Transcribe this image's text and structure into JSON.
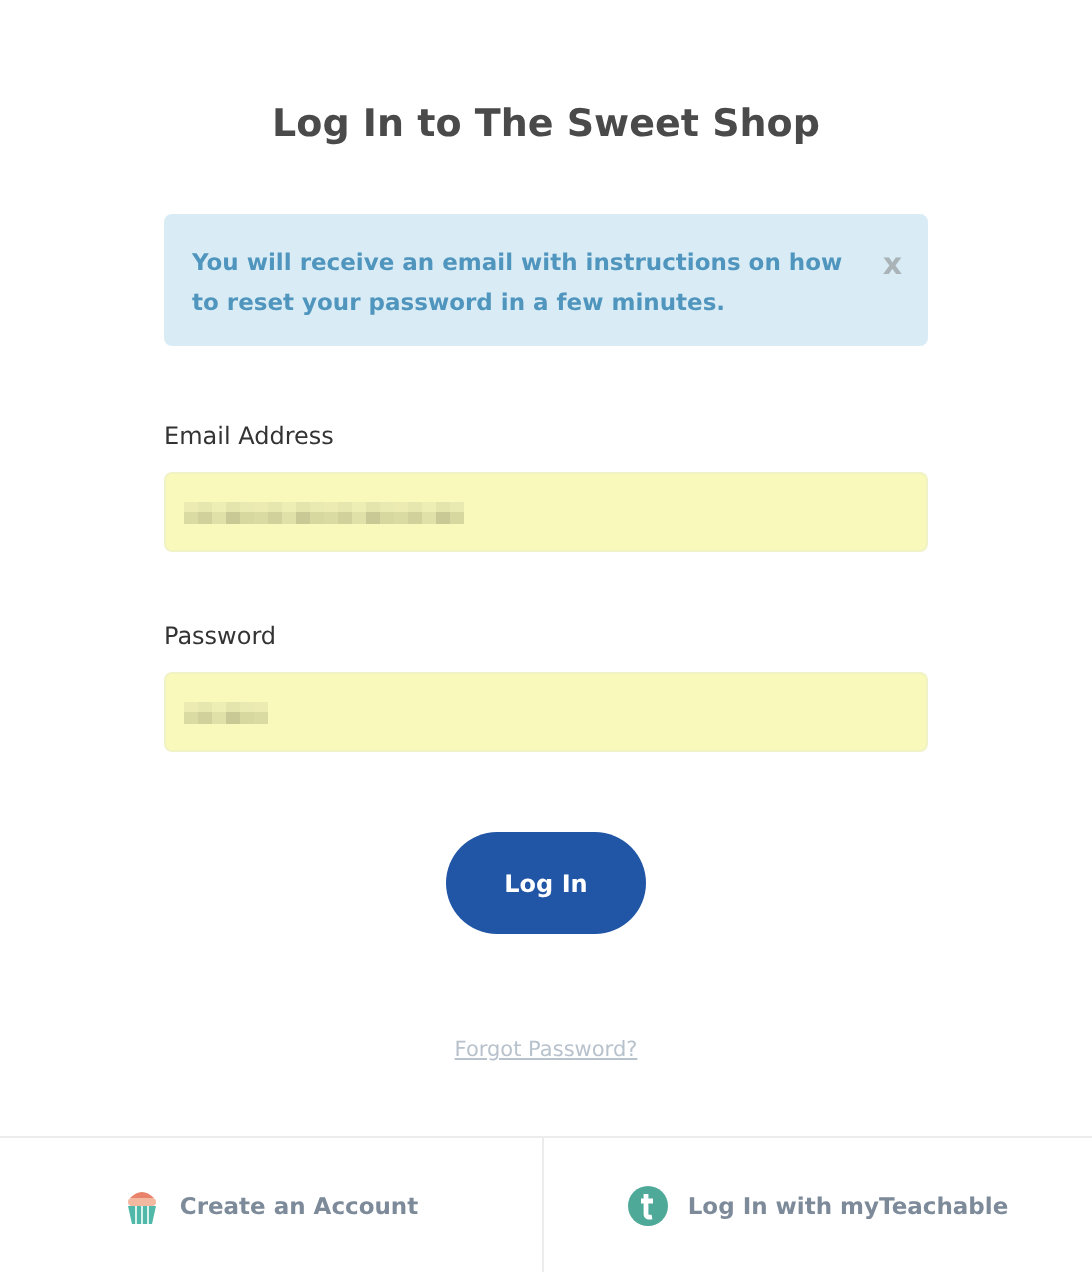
{
  "title": "Log In to The Sweet Shop",
  "alert": {
    "message": "You will receive an email with instructions on how to reset your password in a few minutes.",
    "close": "x"
  },
  "fields": [
    {
      "label": "Email Address",
      "kind": "email",
      "autofilled": true
    },
    {
      "label": "Password",
      "kind": "password",
      "autofilled": true
    }
  ],
  "submit": "Log In",
  "forgot_link": "Forgot Password?",
  "footer": [
    {
      "kind": "cupcake",
      "label": "Create an Account"
    },
    {
      "kind": "teachable",
      "label": "Log In with myTeachable"
    }
  ]
}
